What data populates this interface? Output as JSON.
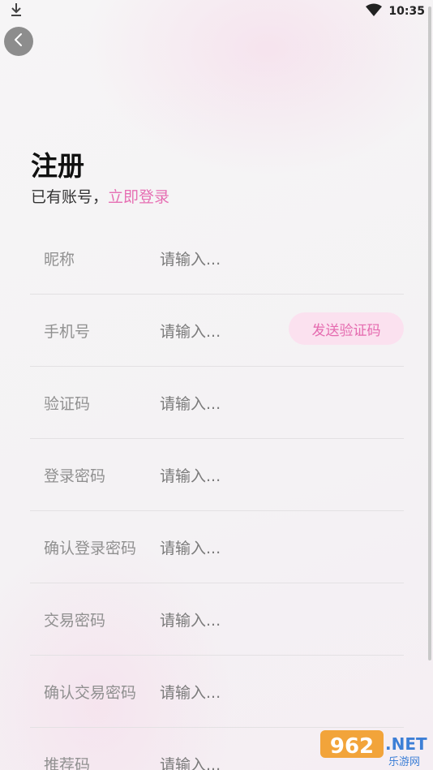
{
  "status_bar": {
    "time": "10:35",
    "icons": [
      "download-icon",
      "wifi-icon"
    ]
  },
  "header": {
    "back_icon": "chevron-left-icon"
  },
  "page": {
    "title": "注册",
    "subtitle_prefix": "已有账号，",
    "login_link": "立即登录"
  },
  "form": {
    "fields": [
      {
        "label": "昵称",
        "placeholder": "请输入..."
      },
      {
        "label": "手机号",
        "placeholder": "请输入...",
        "action": "发送验证码"
      },
      {
        "label": "验证码",
        "placeholder": "请输入..."
      },
      {
        "label": "登录密码",
        "placeholder": "请输入..."
      },
      {
        "label": "确认登录密码",
        "placeholder": "请输入..."
      },
      {
        "label": "交易密码",
        "placeholder": "请输入..."
      },
      {
        "label": "确认交易密码",
        "placeholder": "请输入..."
      },
      {
        "label": "推荐码",
        "placeholder": "请输入..."
      }
    ]
  },
  "watermark": {
    "brand": "962",
    "suffix": ".NET",
    "caption": "乐游网"
  },
  "colors": {
    "accent": "#e66fb3",
    "button_bg": "#fbe1ef",
    "back_button": "#8d8d8d"
  }
}
